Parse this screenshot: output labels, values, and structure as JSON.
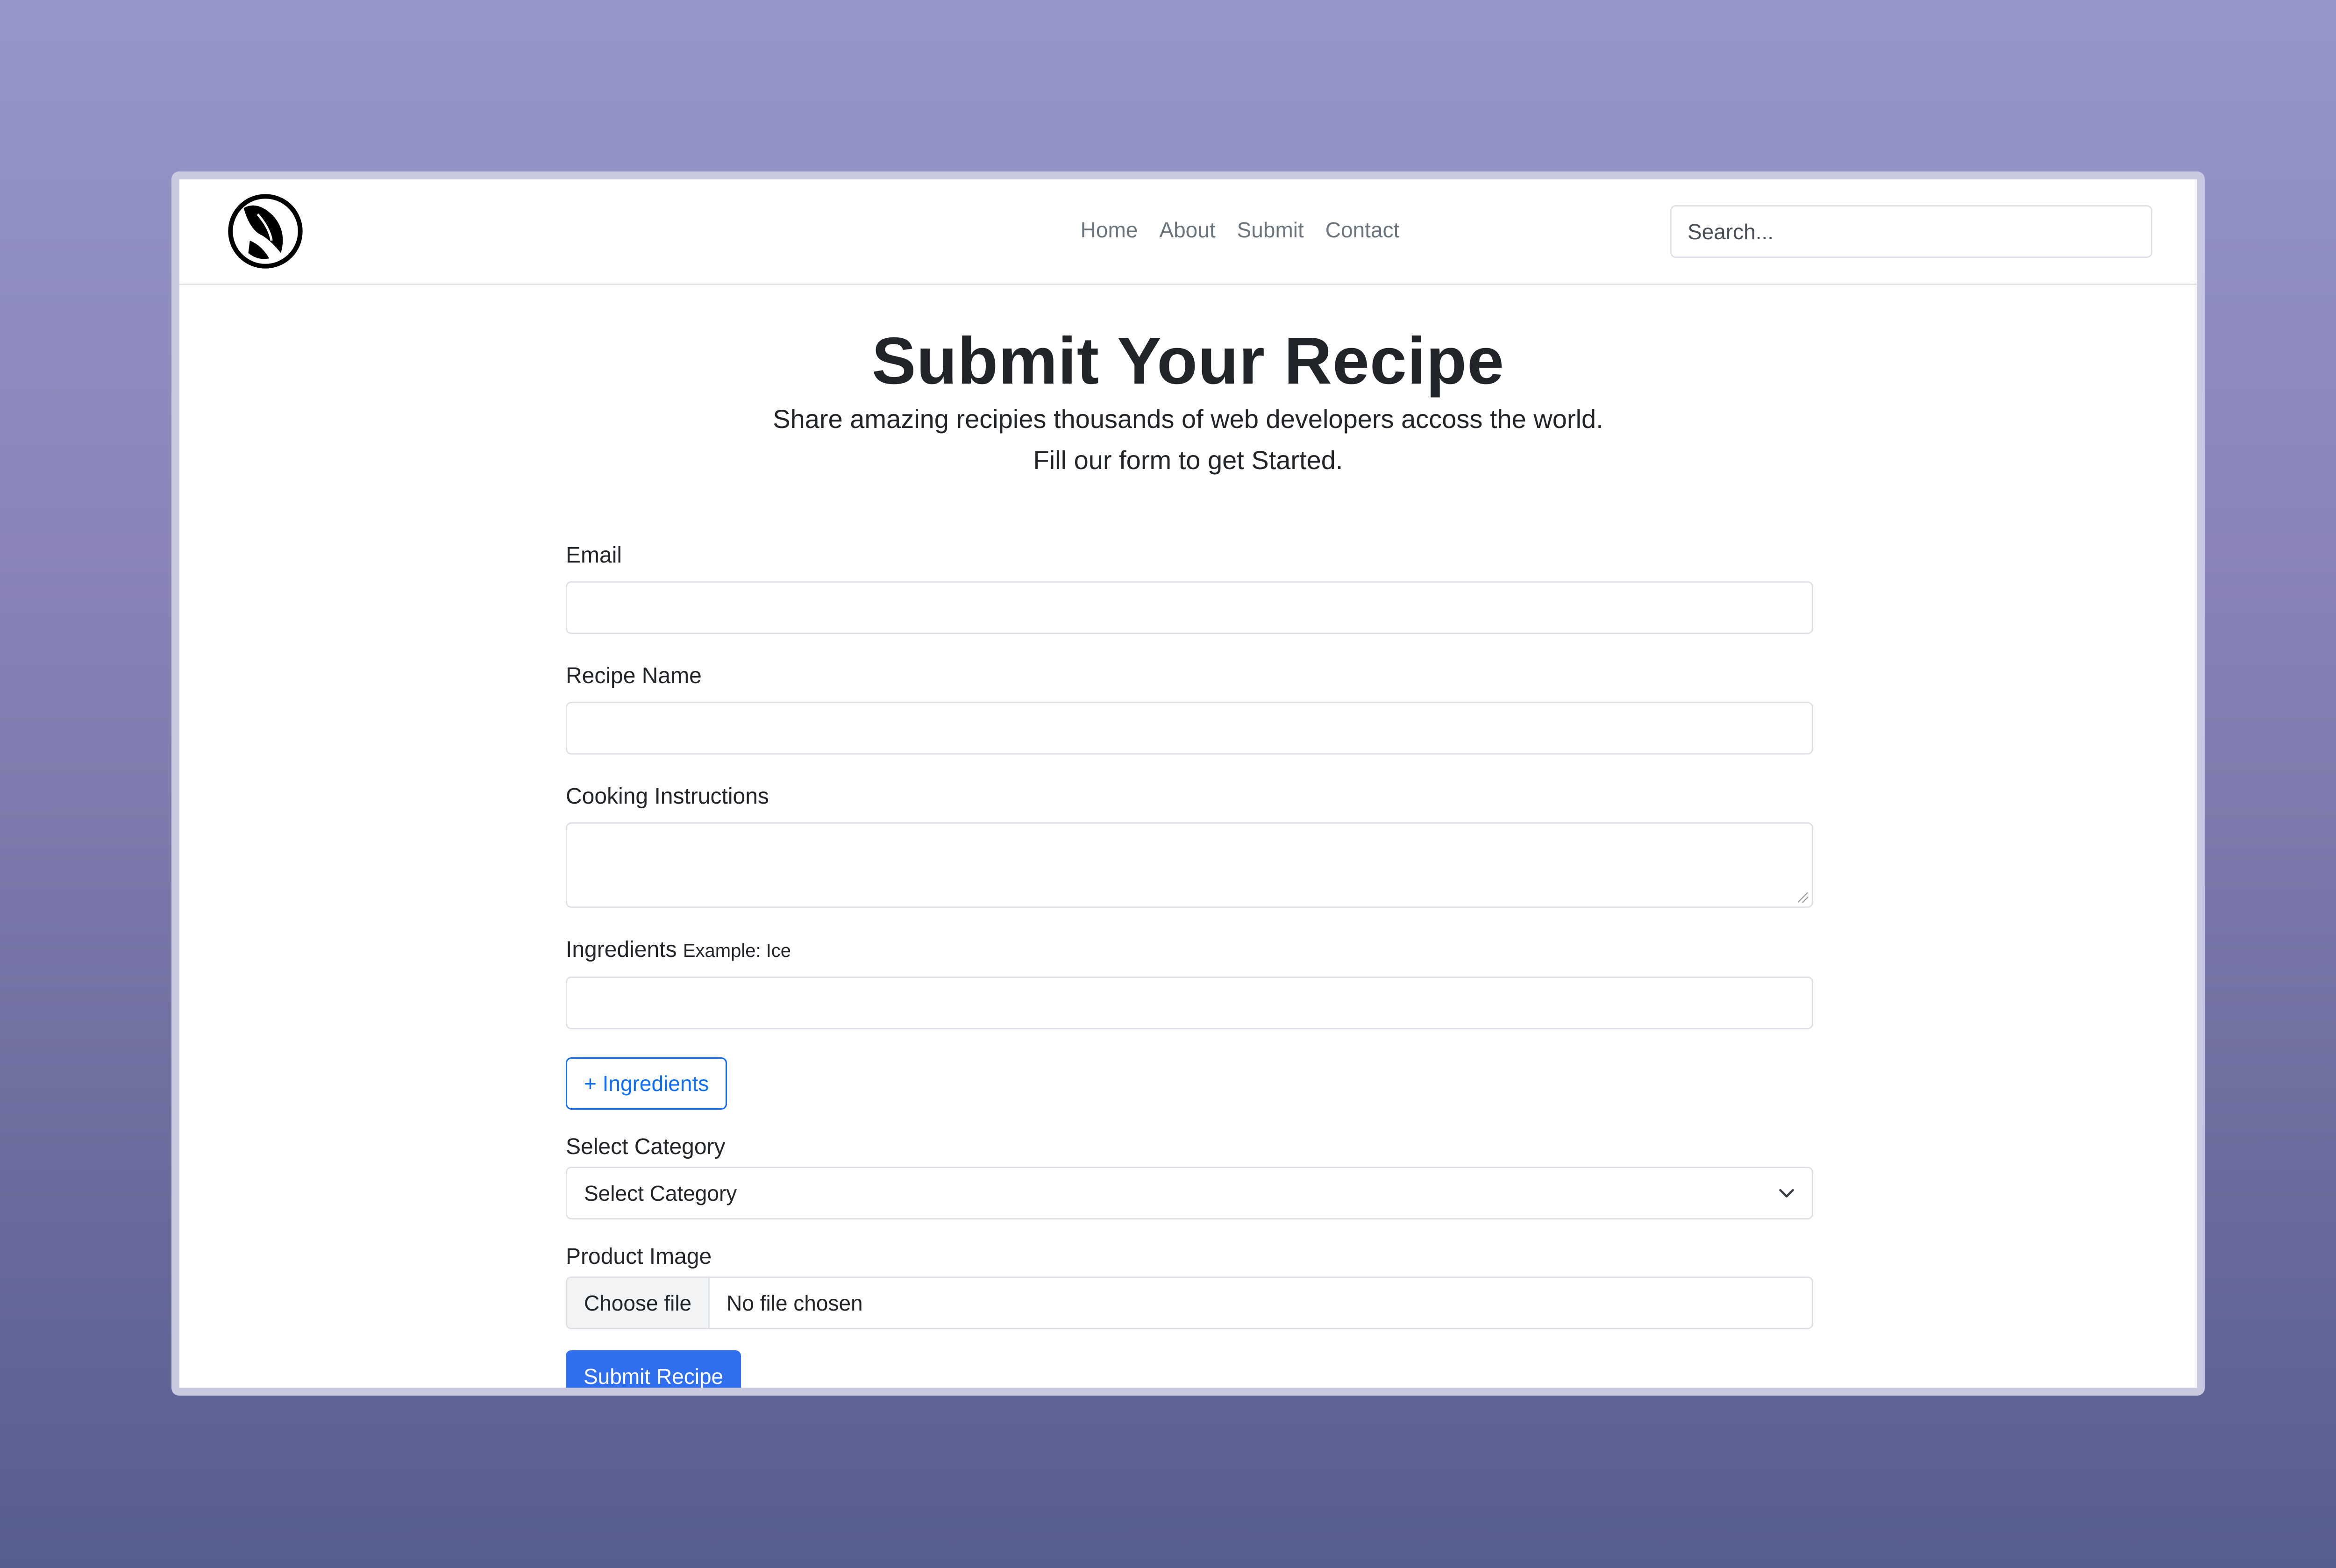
{
  "nav": {
    "logo_icon": "recipe-logo-icon",
    "links": [
      "Home",
      "About",
      "Submit",
      "Contact"
    ],
    "search_placeholder": "Search..."
  },
  "hero": {
    "title": "Submit Your Recipe",
    "subtitle_line1": "Share amazing recipies thousands of web developers accoss the world.",
    "subtitle_line2": "Fill our form to get Started."
  },
  "form": {
    "email_label": "Email",
    "email_value": "",
    "recipe_name_label": "Recipe Name",
    "recipe_name_value": "",
    "instructions_label": "Cooking Instructions",
    "instructions_value": "",
    "ingredients_label": "Ingredients",
    "ingredients_hint": "Example: Ice",
    "ingredients_value": "",
    "add_ingredients_button": "+ Ingredients",
    "category_label": "Select Category",
    "category_selected": "Select Category",
    "image_label": "Product Image",
    "file_button": "Choose file",
    "file_status": "No file chosen",
    "submit_button": "Submit Recipe"
  },
  "colors": {
    "primary": "#2f6ff0",
    "outline": "#0d6efd",
    "text": "#212529",
    "muted": "#6c757d"
  }
}
